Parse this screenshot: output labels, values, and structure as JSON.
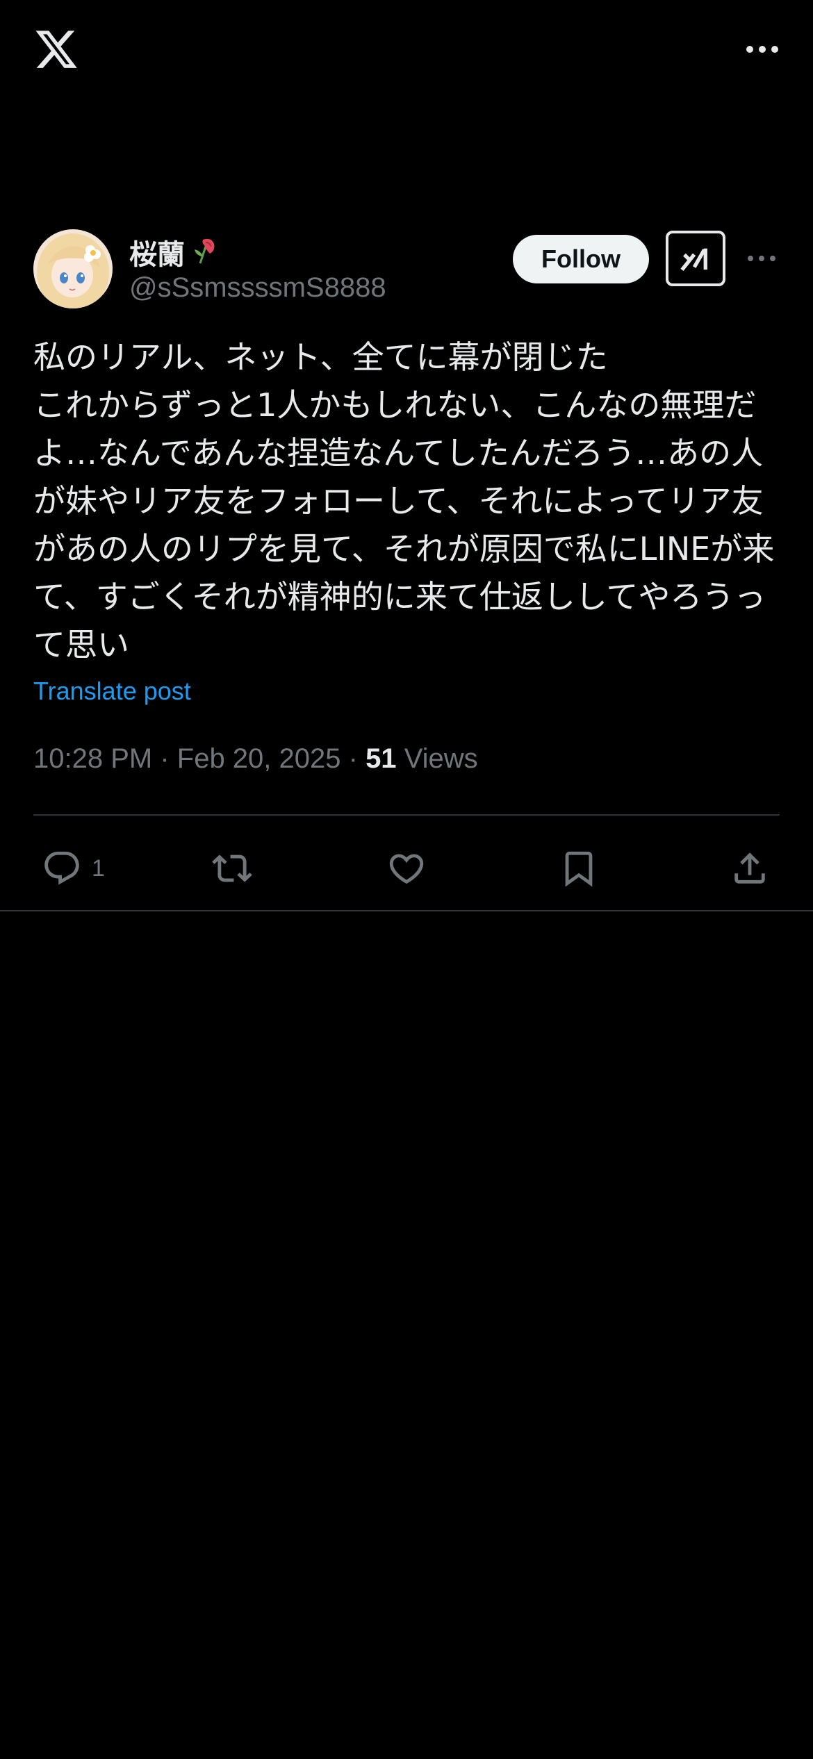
{
  "header": {
    "logo_icon": "x-logo-icon",
    "more_icon": "more-horizontal-icon"
  },
  "post": {
    "display_name": "桜蘭",
    "name_emoji": "🥀",
    "handle": "@sSsmssssmS8888",
    "follow_label": "Follow",
    "grok_icon": "grok-icon",
    "more_icon": "more-horizontal-icon",
    "text": "私のリアル、ネット、全てに幕が閉じた\nこれからずっと1人かもしれない、こんなの無理だよ…なんであんな捏造なんてしたんだろう…あの人が妹やリア友をフォローして、それによってリア友があの人のリプを見て、それが原因で私にLINEが来て、すごくそれが精神的に来て仕返ししてやろうって思い",
    "translate_label": "Translate post",
    "time": "10:28 PM",
    "date": "Feb 20, 2025",
    "separator": " · ",
    "views_count": "51",
    "views_label": "Views",
    "actions": {
      "reply_count": "1",
      "reply_icon": "reply-icon",
      "repost_icon": "repost-icon",
      "like_icon": "heart-icon",
      "bookmark_icon": "bookmark-icon",
      "share_icon": "share-icon"
    }
  },
  "colors": {
    "background": "#000000",
    "text": "#e7e9ea",
    "secondary": "#71767b",
    "link": "#1d9bf0",
    "divider": "#2f3336",
    "follow_bg": "#eff3f4"
  }
}
